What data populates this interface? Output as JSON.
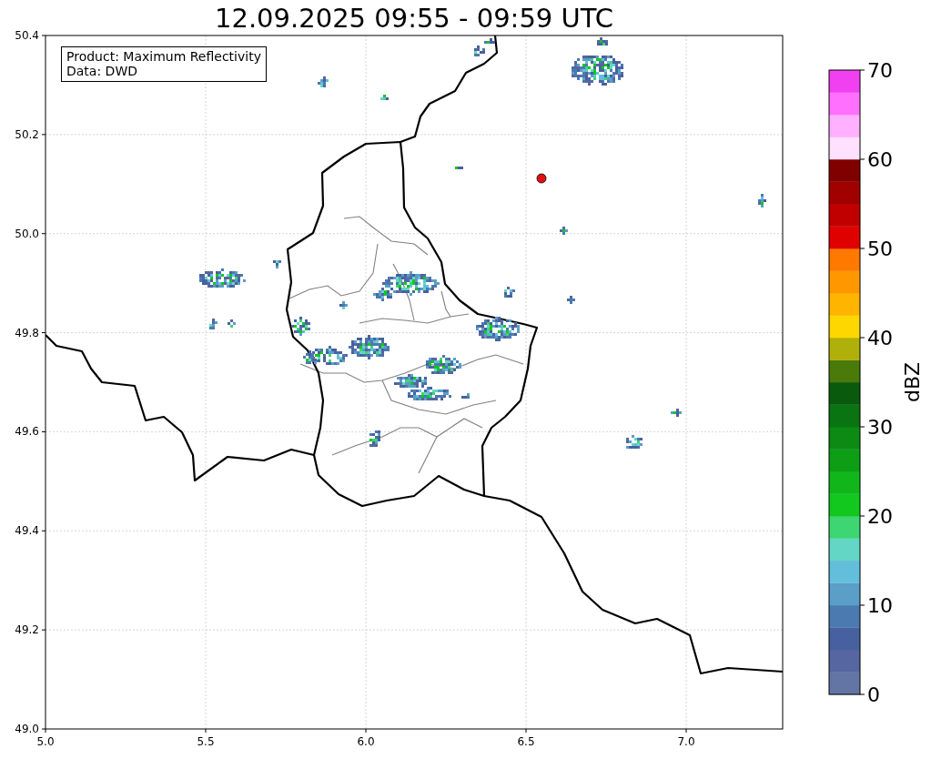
{
  "title": "12.09.2025 09:55 - 09:59 UTC",
  "info_box": {
    "lines": [
      "Product: Maximum Reflectivity",
      "Data: DWD"
    ]
  },
  "map": {
    "xticks": [
      "5.0",
      "5.5",
      "6.0",
      "6.5",
      "7.0"
    ],
    "yticks": [
      "50.4",
      "50.2",
      "50.0",
      "49.8",
      "49.6",
      "49.4",
      "49.2",
      "49.0"
    ]
  },
  "colorbar": {
    "label": "dBZ",
    "ticks": [
      "70",
      "60",
      "50",
      "40",
      "30",
      "20",
      "10",
      "0"
    ],
    "bins": [
      {
        "color": "#6375a5"
      },
      {
        "color": "#5566a0"
      },
      {
        "color": "#4660a0"
      },
      {
        "color": "#4b7ab0"
      },
      {
        "color": "#5b9ec8"
      },
      {
        "color": "#63bedc"
      },
      {
        "color": "#64d6c6"
      },
      {
        "color": "#3ed672"
      },
      {
        "color": "#12c81e"
      },
      {
        "color": "#10b61a"
      },
      {
        "color": "#0e9e16"
      },
      {
        "color": "#0c8a14"
      },
      {
        "color": "#0a7412"
      },
      {
        "color": "#0a5a0e"
      },
      {
        "color": "#4a7a0a"
      },
      {
        "color": "#b0b00a"
      },
      {
        "color": "#ffd700"
      },
      {
        "color": "#ffb400"
      },
      {
        "color": "#ff9800"
      },
      {
        "color": "#ff7800"
      },
      {
        "color": "#e00000"
      },
      {
        "color": "#c00000"
      },
      {
        "color": "#a00000"
      },
      {
        "color": "#800000"
      },
      {
        "color": "#ffe0ff"
      },
      {
        "color": "#ffb0ff"
      },
      {
        "color": "#ff70ff"
      },
      {
        "color": "#f040f0"
      }
    ]
  }
}
